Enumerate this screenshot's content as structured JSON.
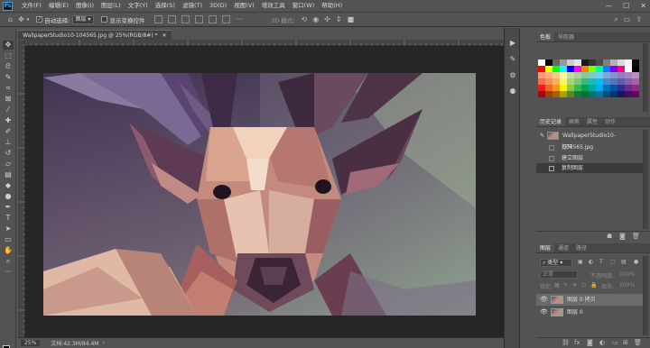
{
  "app": {
    "logo": "Ps"
  },
  "menu": [
    "文件(F)",
    "编辑(E)",
    "图像(I)",
    "图层(L)",
    "文字(Y)",
    "选择(S)",
    "滤镜(T)",
    "3D(D)",
    "视图(V)",
    "增效工具",
    "窗口(W)",
    "帮助(H)"
  ],
  "window_controls": {
    "minimize": "—",
    "maximize": "☐",
    "close": "✕"
  },
  "options": {
    "auto_select_label": "自动选择:",
    "auto_select_value": "图层",
    "show_transform_label": "显示变换控件",
    "mode_label": "3D 模式:"
  },
  "document": {
    "tab_title": "WallpaperStudio10-104565.jpg @ 25%(RGB/8#) *",
    "zoom": "25%",
    "doc_info": "文档:42.3M/84.4M"
  },
  "swatches_panel": {
    "tabs": [
      "色板",
      "导航器"
    ],
    "colors": [
      "#ffffff",
      "#000000",
      "#666666",
      "#999999",
      "#cccccc",
      "#e6e6e6",
      "#1a1a1a",
      "#333333",
      "#4d4d4d",
      "#808080",
      "#b3b3b3",
      "#d9d9d9",
      "#f2f2f2",
      "#0d0d0d",
      "#ff0000",
      "#ffff00",
      "#00ff00",
      "#00ffff",
      "#0000ff",
      "#ff00ff",
      "#ff8000",
      "#80ff00",
      "#00ff80",
      "#0080ff",
      "#8000ff",
      "#ff0080",
      "#ffffff",
      "#000000",
      "#f7977a",
      "#f9ad81",
      "#fdc68a",
      "#fff79a",
      "#c4df9b",
      "#a3d39c",
      "#82ca9d",
      "#7bcdc8",
      "#6ecff6",
      "#7ea7d8",
      "#8493ca",
      "#8882be",
      "#a187be",
      "#bc8dbf",
      "#f26c4f",
      "#f68e55",
      "#fbaf5c",
      "#fff467",
      "#acd372",
      "#7cc576",
      "#3bb878",
      "#1abbb4",
      "#00bff3",
      "#438cca",
      "#5574b9",
      "#605ca8",
      "#855fa8",
      "#a763a8",
      "#ed1c24",
      "#f26522",
      "#f7941d",
      "#fff200",
      "#8dc73f",
      "#39b54a",
      "#00a651",
      "#00a99d",
      "#00aeef",
      "#0072bc",
      "#0054a6",
      "#2e3192",
      "#662d91",
      "#92278f",
      "#9e0b0f",
      "#a0410d",
      "#a36209",
      "#aba000",
      "#598527",
      "#1a7b30",
      "#007236",
      "#00746b",
      "#0076a3",
      "#004b80",
      "#003471",
      "#1b1464",
      "#440e62",
      "#630460"
    ]
  },
  "history_panel": {
    "tabs": [
      "历史记录",
      "画笔",
      "属性",
      "动作"
    ],
    "snapshot": "WallpaperStudio10-104565.jpg",
    "steps": [
      "打开",
      "建立图层",
      "复制图层"
    ]
  },
  "layers_panel": {
    "tabs": [
      "图层",
      "通道",
      "路径"
    ],
    "filter_label": "类型",
    "blend_mode": "正常",
    "opacity_label": "不透明度:",
    "opacity_value": "100%",
    "lock_label": "锁定:",
    "fill_label": "填充:",
    "fill_value": "100%",
    "layers": [
      {
        "name": "图层 0 拷贝",
        "selected": true
      },
      {
        "name": "图层 0",
        "selected": false
      }
    ]
  }
}
